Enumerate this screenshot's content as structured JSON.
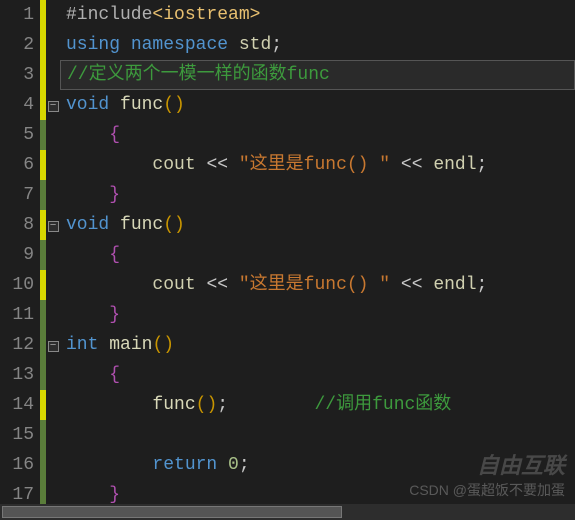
{
  "lines": [
    {
      "num": "1",
      "change": "modified",
      "fold": "",
      "tokens": [
        [
          "tok-preproc",
          "#include"
        ],
        [
          "tok-angle",
          "<iostream>"
        ]
      ]
    },
    {
      "num": "2",
      "change": "modified",
      "fold": "",
      "tokens": [
        [
          "tok-keyword",
          "using"
        ],
        [
          "",
          " "
        ],
        [
          "tok-keyword",
          "namespace"
        ],
        [
          "",
          " "
        ],
        [
          "tok-ident",
          "std"
        ],
        [
          "tok-punct",
          ";"
        ]
      ]
    },
    {
      "num": "3",
      "change": "modified",
      "fold": "",
      "highlight": true,
      "tokens": [
        [
          "tok-comment",
          "//定义两个一模一样的函数func"
        ]
      ]
    },
    {
      "num": "4",
      "change": "modified",
      "fold": "box",
      "tokens": [
        [
          "tok-keyword",
          "void"
        ],
        [
          "",
          " "
        ],
        [
          "tok-func",
          "func"
        ],
        [
          "tok-paren",
          "()"
        ]
      ]
    },
    {
      "num": "5",
      "change": "saved",
      "fold": "",
      "indent": 1,
      "tokens": [
        [
          "tok-brace",
          "{"
        ]
      ]
    },
    {
      "num": "6",
      "change": "modified",
      "fold": "",
      "indent": 2,
      "tokens": [
        [
          "tok-ident",
          "cout"
        ],
        [
          "",
          " "
        ],
        [
          "tok-punct",
          "<<"
        ],
        [
          "",
          " "
        ],
        [
          "tok-string",
          "\"这里是func() \""
        ],
        [
          "",
          " "
        ],
        [
          "tok-punct",
          "<<"
        ],
        [
          "",
          " "
        ],
        [
          "tok-ident",
          "endl"
        ],
        [
          "tok-punct",
          ";"
        ]
      ]
    },
    {
      "num": "7",
      "change": "saved",
      "fold": "",
      "indent": 1,
      "tokens": [
        [
          "tok-brace",
          "}"
        ]
      ]
    },
    {
      "num": "8",
      "change": "modified",
      "fold": "box",
      "tokens": [
        [
          "tok-keyword",
          "void"
        ],
        [
          "",
          " "
        ],
        [
          "tok-func",
          "func"
        ],
        [
          "tok-paren",
          "()"
        ]
      ]
    },
    {
      "num": "9",
      "change": "saved",
      "fold": "",
      "indent": 1,
      "tokens": [
        [
          "tok-brace",
          "{"
        ]
      ]
    },
    {
      "num": "10",
      "change": "modified",
      "fold": "",
      "indent": 2,
      "tokens": [
        [
          "tok-ident",
          "cout"
        ],
        [
          "",
          " "
        ],
        [
          "tok-punct",
          "<<"
        ],
        [
          "",
          " "
        ],
        [
          "tok-string",
          "\"这里是func() \""
        ],
        [
          "",
          " "
        ],
        [
          "tok-punct",
          "<<"
        ],
        [
          "",
          " "
        ],
        [
          "tok-ident",
          "endl"
        ],
        [
          "tok-punct",
          ";"
        ]
      ]
    },
    {
      "num": "11",
      "change": "saved",
      "fold": "",
      "indent": 1,
      "tokens": [
        [
          "tok-brace",
          "}"
        ]
      ]
    },
    {
      "num": "12",
      "change": "saved",
      "fold": "box",
      "tokens": [
        [
          "tok-type",
          "int"
        ],
        [
          "",
          " "
        ],
        [
          "tok-func",
          "main"
        ],
        [
          "tok-paren",
          "()"
        ]
      ]
    },
    {
      "num": "13",
      "change": "saved",
      "fold": "",
      "indent": 1,
      "tokens": [
        [
          "tok-brace",
          "{"
        ]
      ]
    },
    {
      "num": "14",
      "change": "modified",
      "fold": "",
      "indent": 2,
      "tokens": [
        [
          "tok-func",
          "func"
        ],
        [
          "tok-paren",
          "()"
        ],
        [
          "tok-punct",
          ";"
        ],
        [
          "",
          "        "
        ],
        [
          "tok-comment",
          "//调用func函数"
        ]
      ]
    },
    {
      "num": "15",
      "change": "saved",
      "fold": "",
      "tokens": []
    },
    {
      "num": "16",
      "change": "saved",
      "fold": "",
      "indent": 2,
      "tokens": [
        [
          "tok-keyword",
          "return"
        ],
        [
          "",
          " "
        ],
        [
          "tok-number",
          "0"
        ],
        [
          "tok-punct",
          ";"
        ]
      ]
    },
    {
      "num": "17",
      "change": "saved",
      "fold": "",
      "indent": 1,
      "tokens": [
        [
          "tok-brace",
          "}"
        ]
      ]
    }
  ],
  "fold_symbol": "−",
  "watermark": {
    "brand": "自由互联",
    "credit": "CSDN @蛋超饭不要加蛋"
  }
}
